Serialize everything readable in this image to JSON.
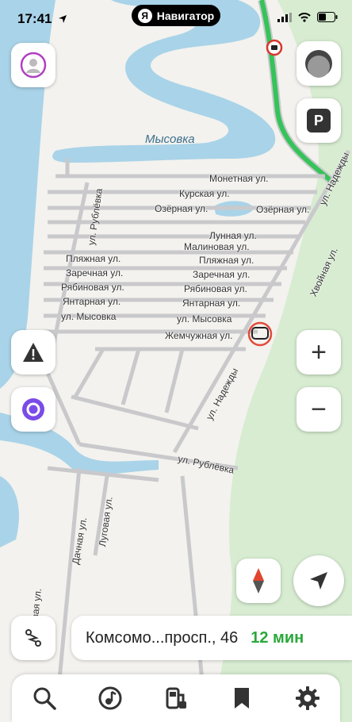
{
  "status_bar": {
    "time": "17:41",
    "app_pill": "Навигатор",
    "logo_letter": "Я"
  },
  "map": {
    "place_label": "Мысовка",
    "streets": {
      "monetnaya": "Монетная ул.",
      "kurskaya": "Курская ул.",
      "ozernaya_1": "Озёрная ул.",
      "ozernaya_2": "Озёрная ул.",
      "nadezhdy_top": "ул. Надежды",
      "lunnaya": "Лунная ул.",
      "malinovaya": "Малиновая ул.",
      "plyazhnaya_1": "Пляжная ул.",
      "plyazhnaya_2": "Пляжная ул.",
      "zarechnaya_1": "Заречная ул.",
      "zarechnaya_2": "Заречная ул.",
      "ryabinovaya_1": "Рябиновая ул.",
      "ryabinovaya_2": "Рябиновая ул.",
      "yantarnaya_1": "Янтарная ул.",
      "yantarnaya_2": "Янтарная ул.",
      "mysovka_1": "ул. Мысовка",
      "mysovka_2": "ул. Мысовка",
      "zhemchuzhnaya": "Жемчужная ул.",
      "rublevka_1": "ул. Рублёвка",
      "rublevka_2": "ул. Рублёвка",
      "nadezhdy_mid": "ул. Надежды",
      "hvoynaya": "Хвойная ул.",
      "dachnaya": "Дачная ул.",
      "lugovaya": "Луговая ул.",
      "beregovaya": "Береговая ул."
    }
  },
  "controls": {
    "parking_label": "P",
    "zoom_in": "+",
    "zoom_out": "−"
  },
  "route": {
    "destination": "Комсомо...просп., 46",
    "eta": "12 мин"
  },
  "colors": {
    "water": "#a9d3e8",
    "forest": "#d7ecd1",
    "road": "#c9c9cc",
    "route_green": "#36c35a",
    "eta_green": "#2aa83a"
  },
  "tabbar": {
    "icons": [
      "search-icon",
      "music-icon",
      "fuel-icon",
      "bookmark-icon",
      "settings-icon"
    ]
  }
}
